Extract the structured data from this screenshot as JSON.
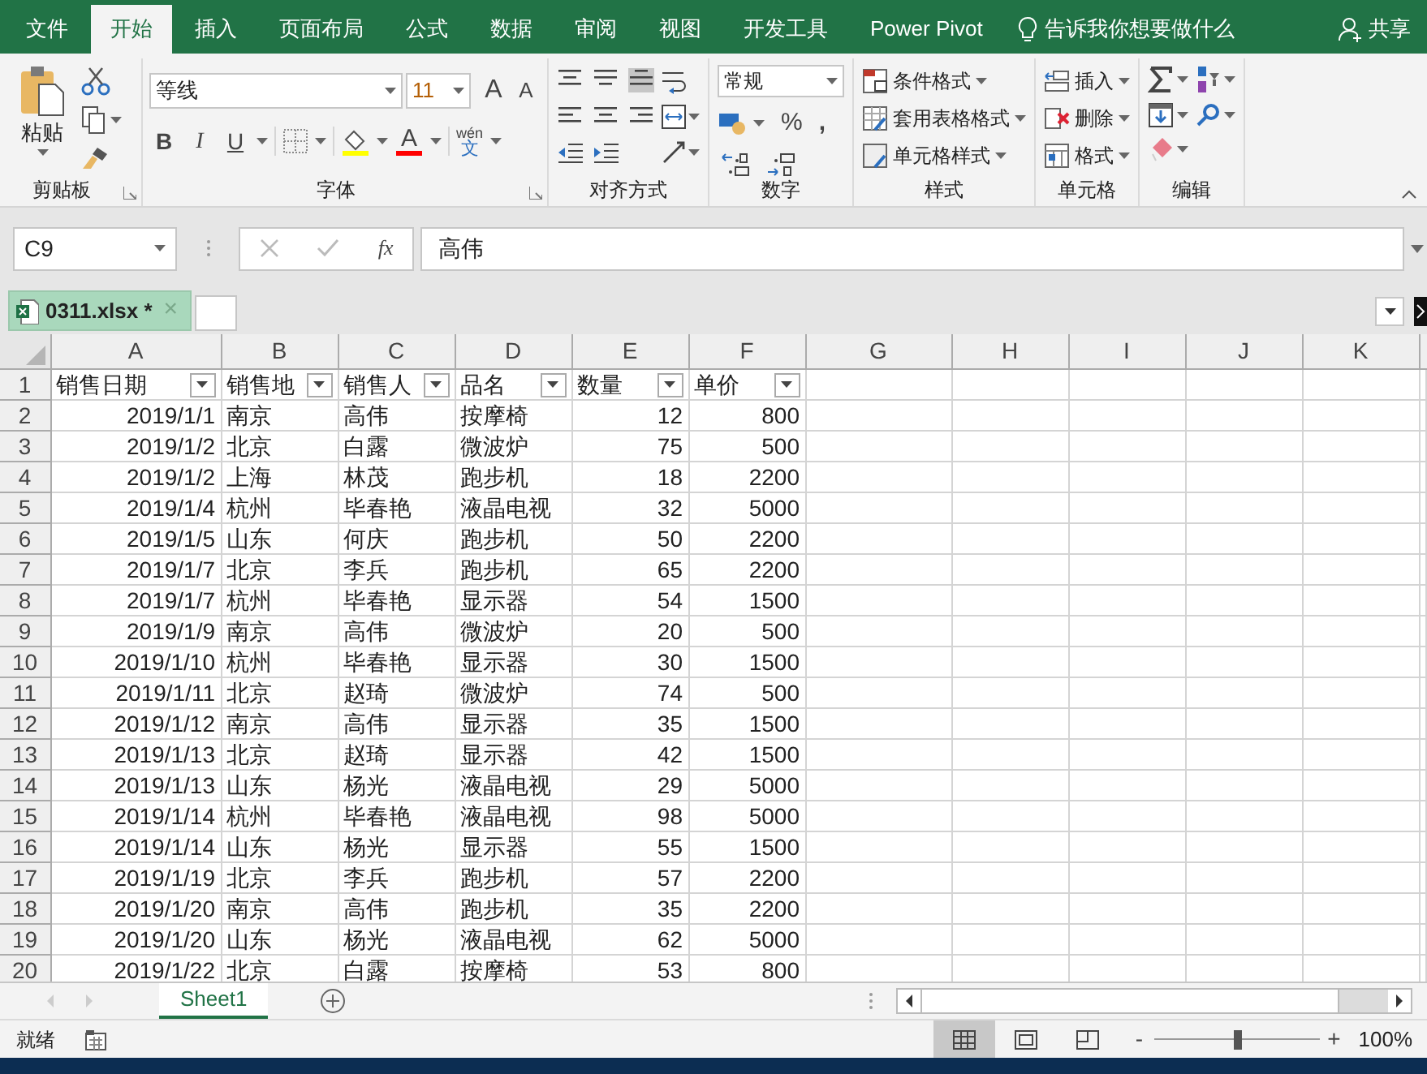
{
  "ribbon_tabs": [
    {
      "label": "文件",
      "selected": false
    },
    {
      "label": "开始",
      "selected": true
    },
    {
      "label": "插入",
      "selected": false
    },
    {
      "label": "页面布局",
      "selected": false
    },
    {
      "label": "公式",
      "selected": false
    },
    {
      "label": "数据",
      "selected": false
    },
    {
      "label": "审阅",
      "selected": false
    },
    {
      "label": "视图",
      "selected": false
    },
    {
      "label": "开发工具",
      "selected": false
    },
    {
      "label": "Power Pivot",
      "selected": false
    }
  ],
  "tell_me": "告诉我你想要做什么",
  "share": "共享",
  "ribbon": {
    "clipboard": {
      "paste": "粘贴",
      "label": "剪贴板"
    },
    "font": {
      "name": "等线",
      "size": "11",
      "grow": "A",
      "shrink": "A",
      "bold": "B",
      "italic": "I",
      "underline": "U",
      "font_color": "A",
      "pinyin_top": "wén",
      "pinyin_bottom": "文",
      "label": "字体"
    },
    "alignment": {
      "label": "对齐方式"
    },
    "number": {
      "format": "常规",
      "percent": "%",
      "comma": ",",
      "label": "数字"
    },
    "styles": {
      "items": [
        "条件格式",
        "套用表格格式",
        "单元格样式"
      ],
      "label": "样式"
    },
    "cells": {
      "items": [
        "插入",
        "删除",
        "格式"
      ],
      "label": "单元格"
    },
    "editing": {
      "label": "编辑"
    }
  },
  "formula_bar": {
    "name_box": "C9",
    "fx": "fx",
    "value": "高伟"
  },
  "workbook_tab": {
    "label": "0311.xlsx *",
    "close": "×"
  },
  "sheet": {
    "columns": [
      "A",
      "B",
      "C",
      "D",
      "E",
      "F",
      "G",
      "H",
      "I",
      "J",
      "K"
    ],
    "row_numbers": [
      "1",
      "2",
      "3",
      "4",
      "5",
      "6",
      "7",
      "8",
      "9",
      "10",
      "11",
      "12",
      "13",
      "14",
      "15",
      "16",
      "17",
      "18",
      "19",
      "20"
    ],
    "header_row": [
      "销售日期",
      "销售地",
      "销售人",
      "品名",
      "数量",
      "单价"
    ],
    "rows": [
      [
        "2019/1/1",
        "南京",
        "高伟",
        "按摩椅",
        "12",
        "800"
      ],
      [
        "2019/1/2",
        "北京",
        "白露",
        "微波炉",
        "75",
        "500"
      ],
      [
        "2019/1/2",
        "上海",
        "林茂",
        "跑步机",
        "18",
        "2200"
      ],
      [
        "2019/1/4",
        "杭州",
        "毕春艳",
        "液晶电视",
        "32",
        "5000"
      ],
      [
        "2019/1/5",
        "山东",
        "何庆",
        "跑步机",
        "50",
        "2200"
      ],
      [
        "2019/1/7",
        "北京",
        "李兵",
        "跑步机",
        "65",
        "2200"
      ],
      [
        "2019/1/7",
        "杭州",
        "毕春艳",
        "显示器",
        "54",
        "1500"
      ],
      [
        "2019/1/9",
        "南京",
        "高伟",
        "微波炉",
        "20",
        "500"
      ],
      [
        "2019/1/10",
        "杭州",
        "毕春艳",
        "显示器",
        "30",
        "1500"
      ],
      [
        "2019/1/11",
        "北京",
        "赵琦",
        "微波炉",
        "74",
        "500"
      ],
      [
        "2019/1/12",
        "南京",
        "高伟",
        "显示器",
        "35",
        "1500"
      ],
      [
        "2019/1/13",
        "北京",
        "赵琦",
        "显示器",
        "42",
        "1500"
      ],
      [
        "2019/1/13",
        "山东",
        "杨光",
        "液晶电视",
        "29",
        "5000"
      ],
      [
        "2019/1/14",
        "杭州",
        "毕春艳",
        "液晶电视",
        "98",
        "5000"
      ],
      [
        "2019/1/14",
        "山东",
        "杨光",
        "显示器",
        "55",
        "1500"
      ],
      [
        "2019/1/19",
        "北京",
        "李兵",
        "跑步机",
        "57",
        "2200"
      ],
      [
        "2019/1/20",
        "南京",
        "高伟",
        "跑步机",
        "35",
        "2200"
      ],
      [
        "2019/1/20",
        "山东",
        "杨光",
        "液晶电视",
        "62",
        "5000"
      ],
      [
        "2019/1/22",
        "北京",
        "白露",
        "按摩椅",
        "53",
        "800"
      ]
    ]
  },
  "sheet_tabs": [
    {
      "label": "Sheet1",
      "selected": true
    }
  ],
  "status_bar": {
    "text": "就绪",
    "zoom_out": "-",
    "zoom_in": "+",
    "zoom": {
      "level": 0.5
    },
    "zoom_percent": "100%"
  }
}
